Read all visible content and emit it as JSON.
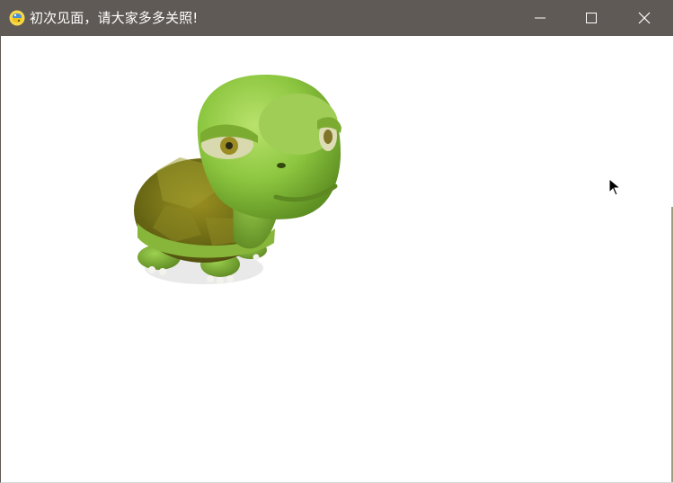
{
  "window": {
    "title": "初次见面，请大家多多关照!",
    "icon": "python-icon",
    "controls": {
      "minimize": "minimize-icon",
      "maximize": "maximize-icon",
      "close": "close-icon"
    }
  },
  "colors": {
    "titlebar": "#5f5a55",
    "content": "#ffffff",
    "turtle_body": "#8cc63f",
    "turtle_shell": "#6a6a18"
  },
  "content": {
    "image": "turtle-image",
    "pointer": "mouse-cursor-icon"
  }
}
